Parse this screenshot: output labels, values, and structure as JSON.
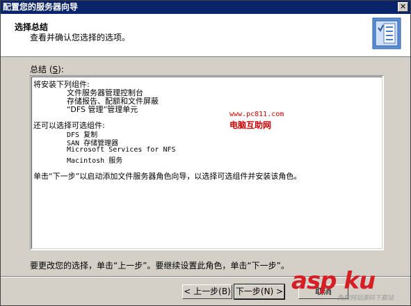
{
  "window": {
    "title": "配置您的服务器向导",
    "close_glyph": "✕"
  },
  "header": {
    "title": "选择总结",
    "subtitle": "查看并确认您选择的选项。"
  },
  "summary": {
    "label_prefix": "总结 (",
    "label_mnemonic": "S",
    "label_suffix": "):",
    "lines": [
      "将安装下列组件:",
      "文件服务器管理控制台",
      "存储报告、配额和文件屏蔽",
      "“DFS 管理”管理单元",
      "还可以选择可选组件:",
      "DFS 复制",
      "SAN 存储管理器",
      "Microsoft Services for NFS",
      "Macintosh 服务",
      "单击“下一步”以启动添加文件服务器角色向导，以选择可选组件并安装该角色。"
    ]
  },
  "watermark": {
    "url": "www.pc811.com",
    "name": "电脑互助网"
  },
  "footer": {
    "text": "要更改您的选择，单击“上一步”。要继续设置此角色，单击“下一步”。"
  },
  "buttons": {
    "back": "< 上一步(B)",
    "next": "下一步(N) >",
    "cancel": "取消"
  },
  "logo": {
    "text": "asp ku",
    "sub": "免费网站源码下载站"
  }
}
